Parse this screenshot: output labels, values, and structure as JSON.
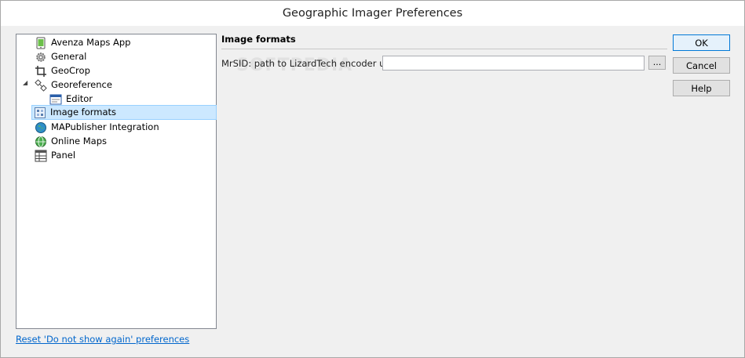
{
  "window": {
    "title": "Geographic Imager Preferences"
  },
  "tree": {
    "items": [
      {
        "label": "Avenza Maps App",
        "icon": "mobile-map-icon"
      },
      {
        "label": "General",
        "icon": "gear-icon"
      },
      {
        "label": "GeoCrop",
        "icon": "crop-icon"
      },
      {
        "label": "Georeference",
        "icon": "georeference-icon"
      },
      {
        "label": "Editor",
        "icon": "editor-icon"
      },
      {
        "label": "Image formats",
        "icon": "image-formats-icon"
      },
      {
        "label": "MAPublisher Integration",
        "icon": "globe-icon"
      },
      {
        "label": "Online Maps",
        "icon": "online-globe-icon"
      },
      {
        "label": "Panel",
        "icon": "panel-grid-icon"
      }
    ],
    "selected_label": "Image formats"
  },
  "reset_link": "Reset 'Do not show again' preferences",
  "panel": {
    "title": "Image formats",
    "mrsid_label": "MrSID: path to LizardTech encoder utility:",
    "mrsid_value": "",
    "browse_label": "..."
  },
  "buttons": {
    "ok": "OK",
    "cancel": "Cancel",
    "help": "Help"
  },
  "watermark": "SOFTPEDIA",
  "colors": {
    "selection_bg": "#cce8ff",
    "selection_border": "#99d1ff",
    "link": "#0066cc"
  }
}
